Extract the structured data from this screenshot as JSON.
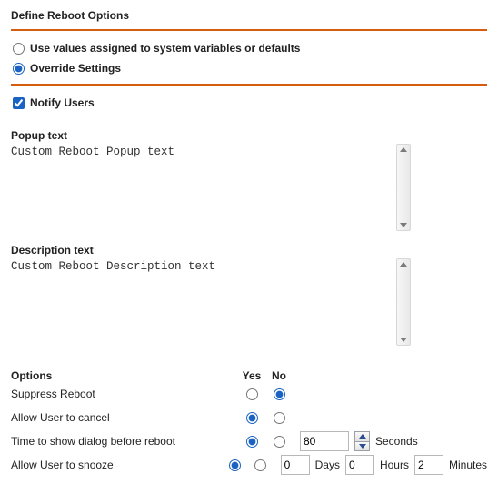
{
  "section_title": "Define Reboot Options",
  "mode": {
    "use_defaults_label": "Use values assigned to system variables or defaults",
    "override_label": "Override Settings",
    "selected": "override"
  },
  "notify": {
    "label": "Notify Users",
    "checked": true
  },
  "popup": {
    "label": "Popup text",
    "value": "Custom Reboot Popup text"
  },
  "description": {
    "label": "Description text",
    "value": "Custom Reboot Description text"
  },
  "options": {
    "header": "Options",
    "yes": "Yes",
    "no": "No",
    "rows": {
      "suppress": {
        "label": "Suppress Reboot",
        "value": "no"
      },
      "allow_cancel": {
        "label": "Allow User to cancel",
        "value": "yes"
      },
      "time_dialog": {
        "label": "Time to show dialog before reboot",
        "value": "yes",
        "seconds": "80",
        "seconds_label": "Seconds"
      },
      "allow_snooze": {
        "label": "Allow User to snooze",
        "value": "yes",
        "days": "0",
        "days_label": "Days",
        "hours": "0",
        "hours_label": "Hours",
        "minutes": "2",
        "minutes_label": "Minutes"
      }
    }
  }
}
